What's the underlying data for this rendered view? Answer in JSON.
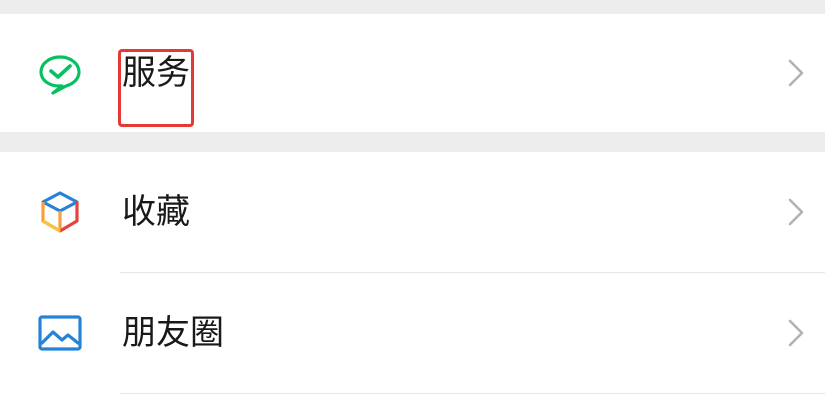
{
  "menu": {
    "items": [
      {
        "label": "服务",
        "icon": "wechat-pay-icon",
        "accent": "#07c160"
      },
      {
        "label": "收藏",
        "icon": "favorites-cube-icon",
        "accent": "#fa9d3b"
      },
      {
        "label": "朋友圈",
        "icon": "moments-image-icon",
        "accent": "#2782d7"
      }
    ]
  },
  "highlight_color": "#e53935"
}
